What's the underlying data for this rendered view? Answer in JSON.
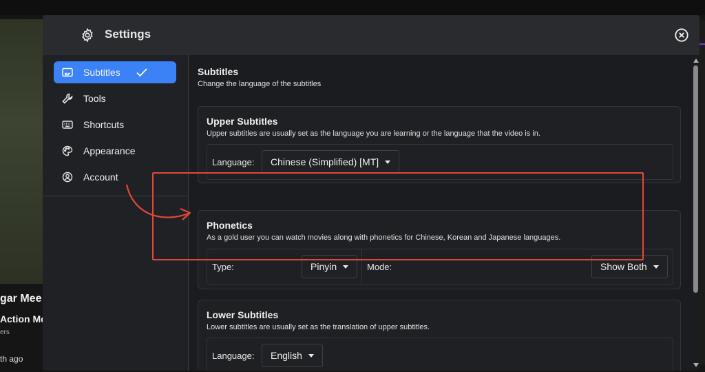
{
  "background": {
    "video_title": "gar Mee",
    "video_subtitle": "Action Mo",
    "video_meta": "ers",
    "video_time": "th ago"
  },
  "header": {
    "title": "Settings",
    "icon": "gear-icon",
    "close_icon": "close-icon"
  },
  "sidebar": {
    "items": [
      {
        "label": "Subtitles",
        "icon": "subtitles-icon",
        "active": true
      },
      {
        "label": "Tools",
        "icon": "wrench-icon",
        "active": false
      },
      {
        "label": "Shortcuts",
        "icon": "keyboard-icon",
        "active": false
      },
      {
        "label": "Appearance",
        "icon": "palette-icon",
        "active": false
      },
      {
        "label": "Account",
        "icon": "account-icon",
        "active": false
      }
    ],
    "active_check_icon": "check-icon"
  },
  "content": {
    "title": "Subtitles",
    "description": "Change the language of the subtitles",
    "upper": {
      "title": "Upper Subtitles",
      "description": "Upper subtitles are usually set as the language you are learning or the language that the video is in.",
      "language_label": "Language:",
      "language_value": "Chinese (Simplified) [MT]"
    },
    "phonetics": {
      "title": "Phonetics",
      "description": "As a gold user you can watch movies along with phonetics for Chinese, Korean and Japanese languages.",
      "type_label": "Type:",
      "type_value": "Pinyin",
      "mode_label": "Mode:",
      "mode_value": "Show Both"
    },
    "lower": {
      "title": "Lower Subtitles",
      "description": "Lower subtitles are usually set as the translation of upper subtitles.",
      "language_label": "Language:",
      "language_value": "English"
    }
  },
  "colors": {
    "accent": "#3b82f6",
    "highlight": "#e1483a",
    "modal_bg": "#202124"
  }
}
